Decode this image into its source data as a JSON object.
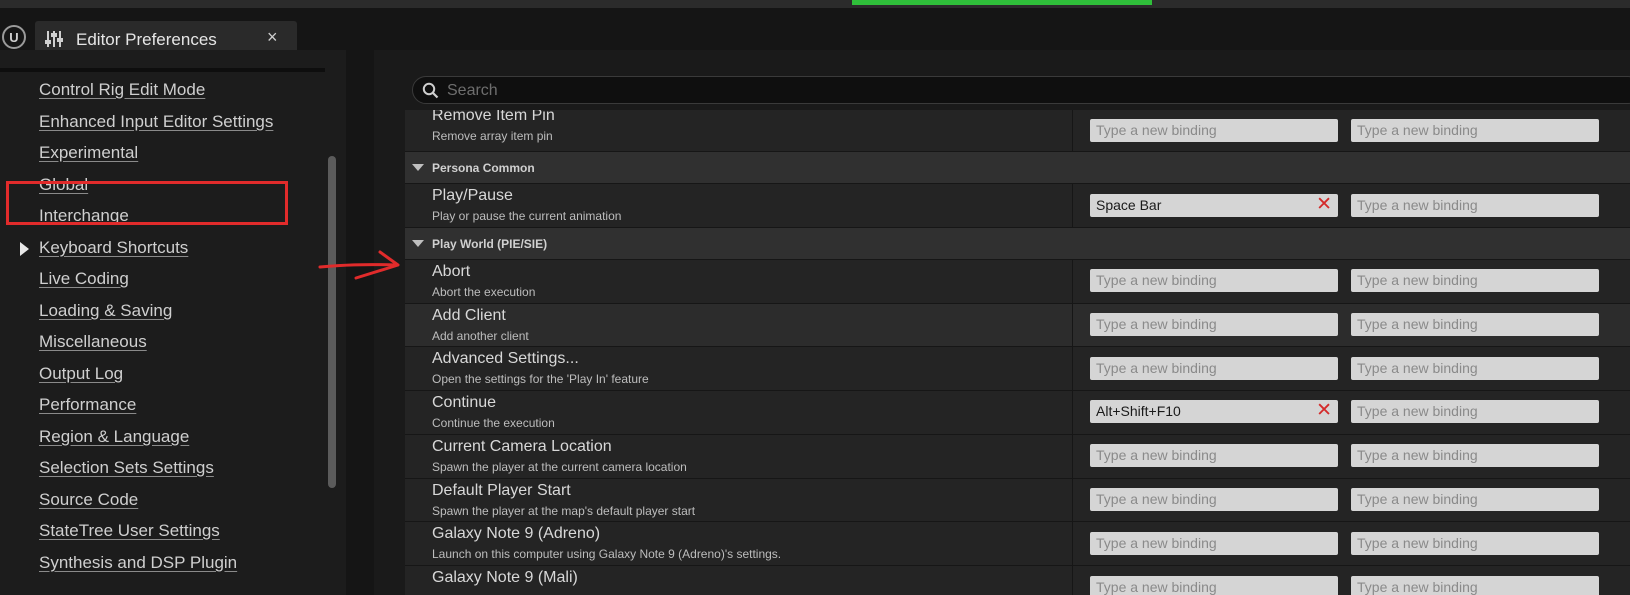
{
  "window": {
    "tab_title": "Editor Preferences",
    "close_glyph": "×",
    "logo_glyph": "U"
  },
  "sidebar": {
    "items": [
      {
        "label": "Control Rig Edit Mode"
      },
      {
        "label": "Enhanced Input Editor Settings"
      },
      {
        "label": "Experimental"
      },
      {
        "label": "Global"
      },
      {
        "label": "Interchange"
      },
      {
        "label": "Keyboard Shortcuts",
        "selected": true
      },
      {
        "label": "Live Coding"
      },
      {
        "label": "Loading & Saving"
      },
      {
        "label": "Miscellaneous"
      },
      {
        "label": "Output Log"
      },
      {
        "label": "Performance"
      },
      {
        "label": "Region & Language"
      },
      {
        "label": "Selection Sets Settings"
      },
      {
        "label": "Source Code"
      },
      {
        "label": "StateTree User Settings"
      },
      {
        "label": "Synthesis and DSP Plugin"
      }
    ]
  },
  "search": {
    "placeholder": "Search",
    "value": ""
  },
  "binding_placeholder": "Type a new binding",
  "categories": [
    {
      "title": "Persona Common"
    },
    {
      "title": "Play World (PIE/SIE)"
    }
  ],
  "rows": [
    {
      "name": "Remove Item Pin",
      "description": "Remove array item pin",
      "binding1": "",
      "binding2": ""
    },
    {
      "name": "Play/Pause",
      "description": "Play or pause the current animation",
      "binding1": "Space Bar",
      "binding2": ""
    },
    {
      "name": "Abort",
      "description": "Abort the execution",
      "binding1": "",
      "binding2": ""
    },
    {
      "name": "Add Client",
      "description": "Add another client",
      "binding1": "",
      "binding2": ""
    },
    {
      "name": "Advanced Settings...",
      "description": "Open the settings for the 'Play In' feature",
      "binding1": "",
      "binding2": ""
    },
    {
      "name": "Continue",
      "description": "Continue the execution",
      "binding1": "Alt+Shift+F10",
      "binding2": ""
    },
    {
      "name": "Current Camera Location",
      "description": "Spawn the player at the current camera location",
      "binding1": "",
      "binding2": ""
    },
    {
      "name": "Default Player Start",
      "description": "Spawn the player at the map's default player start",
      "binding1": "",
      "binding2": ""
    },
    {
      "name": "Galaxy Note 9 (Adreno)",
      "description": "Launch on this computer using Galaxy Note 9 (Adreno)'s settings.",
      "binding1": "",
      "binding2": ""
    },
    {
      "name": "Galaxy Note 9 (Mali)",
      "description": "",
      "binding1": "",
      "binding2": ""
    }
  ],
  "clear_glyph": "✕",
  "colors": {
    "annotation_red": "#e12b2b",
    "clear_red": "#d42a2a",
    "progress_green": "#2fbf3a"
  }
}
